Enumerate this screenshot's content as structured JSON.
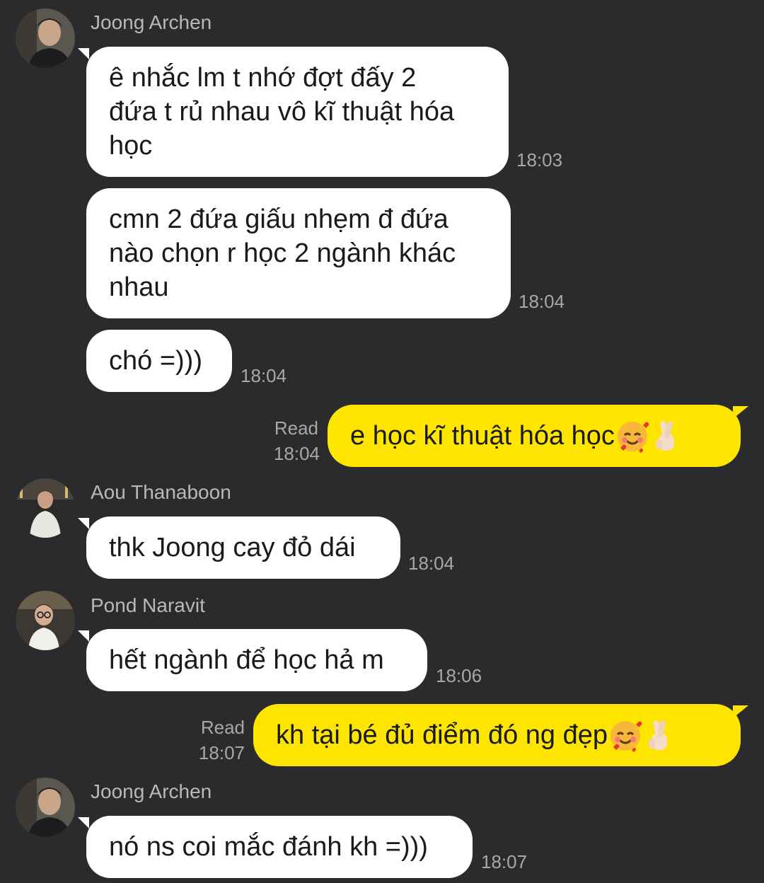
{
  "messages": [
    {
      "sender": "Joong Archen",
      "lines": [
        "ê nhắc lm t nhớ đợt đấy 2",
        "đứa t rủ nhau vô kĩ thuật hóa",
        "học"
      ],
      "time": "18:03"
    },
    {
      "lines": [
        "cmn 2 đứa giấu nhẹm đ đứa",
        "nào chọn r học 2 ngành khác",
        "nhau"
      ],
      "time": "18:04"
    },
    {
      "lines": [
        "chó =)))"
      ],
      "time": "18:04"
    },
    {
      "outgoing": true,
      "text": "e học kĩ thuật hóa học",
      "status": "Read",
      "time": "18:04",
      "emojis": [
        "smiling-face-with-hearts-icon",
        "crossed-fingers-icon"
      ]
    },
    {
      "sender": "Aou Thanaboon",
      "lines": [
        "thk Joong cay đỏ dái"
      ],
      "time": "18:04"
    },
    {
      "sender": "Pond Naravit",
      "lines": [
        "hết ngành để học hả m"
      ],
      "time": "18:06"
    },
    {
      "outgoing": true,
      "text": "kh tại bé đủ điểm đó ng đẹp",
      "status": "Read",
      "time": "18:07",
      "emojis": [
        "smiling-face-with-hearts-icon",
        "crossed-fingers-icon"
      ]
    },
    {
      "sender": "Joong Archen",
      "lines": [
        "nó ns coi mắc đánh kh =)))"
      ],
      "time": "18:07"
    }
  ],
  "colors": {
    "background": "#2b2b2e",
    "incoming_bubble": "#ffffff",
    "outgoing_bubble": "#fee500",
    "meta_text": "#a8a8a8"
  }
}
